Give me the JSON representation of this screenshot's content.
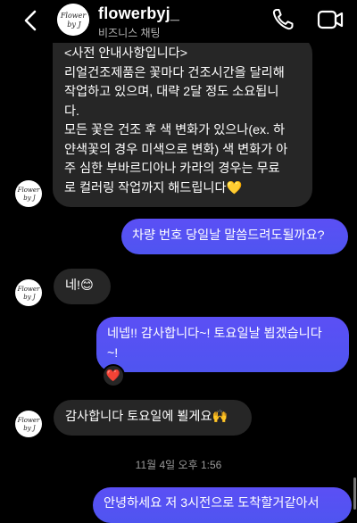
{
  "header": {
    "name": "flowerbyj_",
    "subtitle": "비즈니스 채팅",
    "logo_text_1": "Flower",
    "logo_text_2": "by J"
  },
  "messages": {
    "m1": {
      "lines": [
        "<사전 안내사항입니다>",
        "리얼건조제품은 꽃마다 건조시간을 달리해",
        "작업하고 있으며, 대략 2달 정도 소요됩니",
        "다.",
        "모든 꽃은 건조 후 색 변화가 있으나(ex. 하",
        "얀색꽃의 경우 미색으로 변화) 색 변화가 아",
        "주 심한 부바르디아나 카라의 경우는 무료",
        "로 컬러링 작업까지 해드립니다💛"
      ]
    },
    "m2": {
      "text": "차량 번호 당일날 말씀드려도될까요?"
    },
    "m3": {
      "text": "네!😊"
    },
    "m4": {
      "line1": "네넵!! 감사합니다~! 토요일날 뵙겠습니다",
      "line2": "~!"
    },
    "m4_reaction": "❤️",
    "m5": {
      "text": "감사합니다 토요일에 뵐게요🙌"
    },
    "timestamp": "11월 4일 오후 1:56",
    "m6": {
      "text": "안녕하세요 저 3시전으로 도착할거같아서"
    }
  },
  "icons": {
    "back": "chevron-left-icon",
    "call": "phone-icon",
    "video": "video-camera-icon"
  },
  "colors": {
    "background": "#000000",
    "incoming_bubble": "#262626",
    "outgoing_bubble": "#5b4ff5"
  }
}
